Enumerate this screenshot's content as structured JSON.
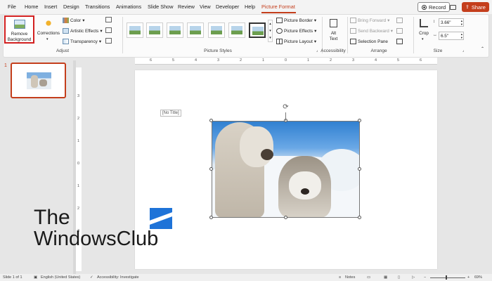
{
  "tabs": [
    "File",
    "Home",
    "Insert",
    "Design",
    "Transitions",
    "Animations",
    "Slide Show",
    "Review",
    "View",
    "Developer",
    "Help",
    "Picture Format"
  ],
  "active_tab": "Picture Format",
  "top_buttons": {
    "record": "Record",
    "share": "Share"
  },
  "ribbon": {
    "adjust": {
      "remove_background": [
        "Remove",
        "Background"
      ],
      "corrections": "Corrections",
      "color": "Color",
      "artistic_effects": "Artistic Effects",
      "transparency": "Transparency",
      "label": "Adjust"
    },
    "picture_styles": {
      "label": "Picture Styles",
      "picture_border": "Picture Border",
      "picture_effects": "Picture Effects",
      "picture_layout": "Picture Layout"
    },
    "accessibility": {
      "alt_text": [
        "Alt",
        "Text"
      ],
      "label": "Accessibility"
    },
    "arrange": {
      "bring_forward": "Bring Forward",
      "send_backward": "Send Backward",
      "selection_pane": "Selection Pane",
      "label": "Arrange"
    },
    "size": {
      "crop": "Crop",
      "height": "3.66\"",
      "width": "6.5\"",
      "label": "Size"
    }
  },
  "ruler_numbers": [
    "6",
    "5",
    "4",
    "3",
    "2",
    "1",
    "0",
    "1",
    "2",
    "3",
    "4",
    "5",
    "6"
  ],
  "ruler_v_numbers": [
    "3",
    "2",
    "1",
    "0",
    "1",
    "2",
    "3"
  ],
  "slide_number": "1",
  "placeholder_title": "[No Title]",
  "watermark": [
    "The",
    "WindowsClub"
  ],
  "status": {
    "slide": "Slide 1 of 1",
    "language": "English (United States)",
    "accessibility": "Accessibility: Investigate",
    "notes": "Notes",
    "zoom": "69%"
  },
  "colors": {
    "accent": "#c43e1c",
    "highlight_box": "#d22020"
  }
}
